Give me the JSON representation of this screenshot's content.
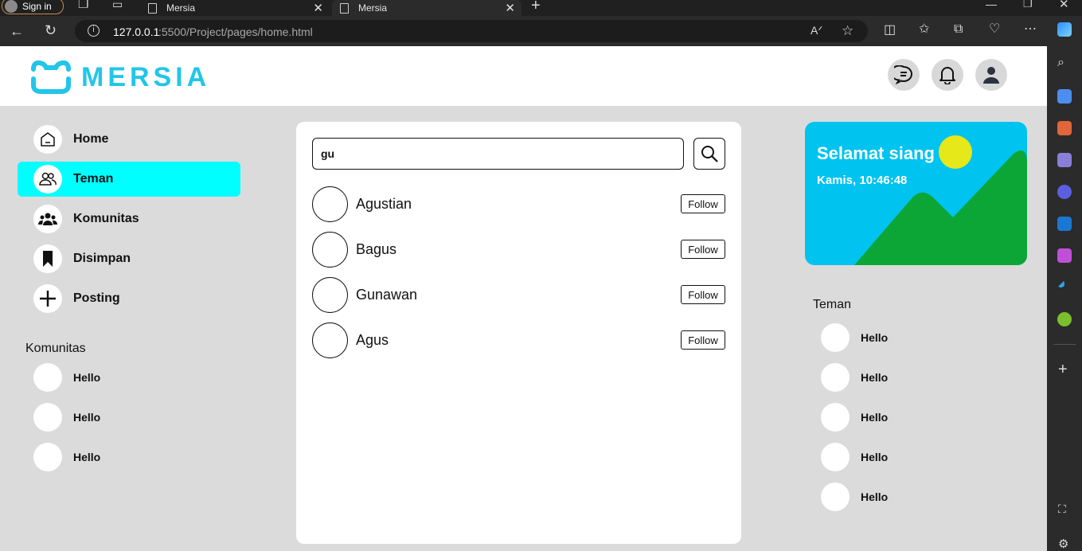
{
  "browser": {
    "sign_in": "Sign in",
    "tabs": [
      {
        "title": "Mersia"
      },
      {
        "title": "Mersia"
      }
    ],
    "url_host": "127.0.0.1",
    "url_path": ":5500/Project/pages/home.html"
  },
  "brand": {
    "name": "MERSIA",
    "color": "#21c6e8"
  },
  "nav": {
    "items": [
      {
        "label": "Home",
        "icon": "home-icon"
      },
      {
        "label": "Teman",
        "icon": "friends-icon",
        "active": true
      },
      {
        "label": "Komunitas",
        "icon": "community-icon"
      },
      {
        "label": "Disimpan",
        "icon": "bookmark-icon"
      },
      {
        "label": "Posting",
        "icon": "plus-icon"
      }
    ]
  },
  "komunitas": {
    "title": "Komunitas",
    "items": [
      "Hello",
      "Hello",
      "Hello"
    ]
  },
  "search": {
    "value": "gu"
  },
  "results": [
    {
      "name": "Agustian",
      "action": "Follow"
    },
    {
      "name": "Bagus",
      "action": "Follow"
    },
    {
      "name": "Gunawan",
      "action": "Follow"
    },
    {
      "name": "Agus",
      "action": "Follow"
    }
  ],
  "greeting": {
    "title": "Selamat siang",
    "datetime": "Kamis, 10:46:48",
    "sky_color": "#00c3f0",
    "sun_color": "#e6e81a",
    "hill_color": "#0ca636"
  },
  "teman": {
    "title": "Teman",
    "items": [
      "Hello",
      "Hello",
      "Hello",
      "Hello",
      "Hello"
    ]
  },
  "accent": "#00ffff"
}
